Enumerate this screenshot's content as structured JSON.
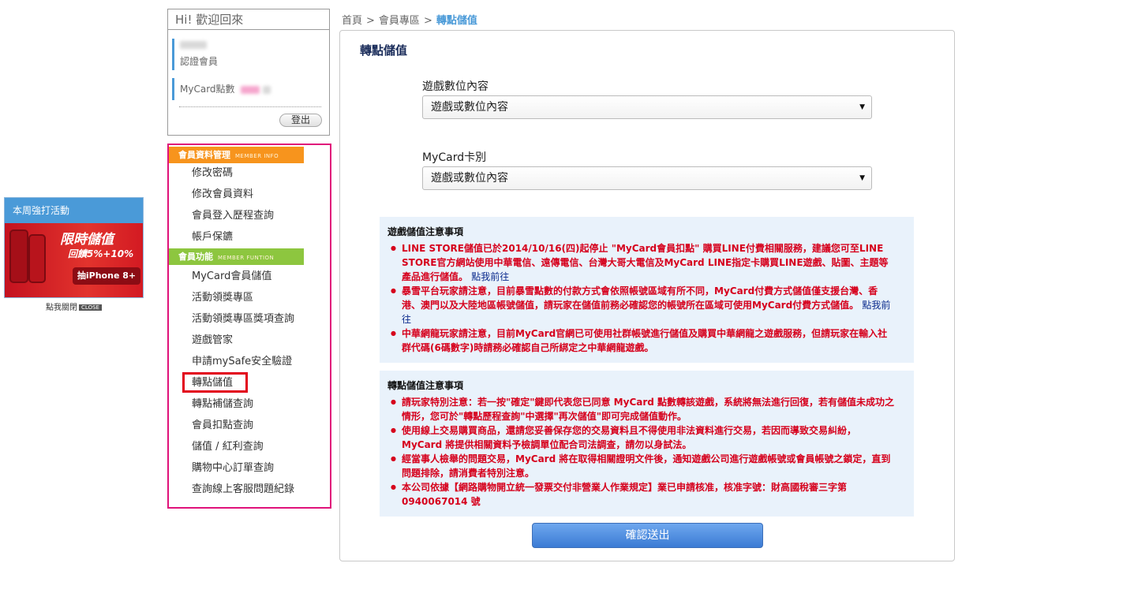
{
  "promo": {
    "header": "本周強打活動",
    "banner_title": "限時儲值",
    "banner_subtitle": "回饋5%+10%",
    "banner_button": "抽iPhone 8+",
    "close_text": "點我關閉",
    "close_tag": "CLOSE"
  },
  "welcome": {
    "title": "Hi! 歡迎回來",
    "member_type": "認證會員",
    "points_label": "MyCard點數",
    "logout": "登出"
  },
  "menu": {
    "section1": {
      "label": "會員資料管理",
      "en": "MEMBER INFO",
      "color": "#f7941d"
    },
    "section1_items": [
      "修改密碼",
      "修改會員資料",
      "會員登入歷程查詢",
      "帳戶保鑣"
    ],
    "section2": {
      "label": "會員功能",
      "en": "MEMBER FUNTION",
      "color": "#8dc63f"
    },
    "section2_items": [
      "MyCard會員儲值",
      "活動領獎專區",
      "活動領獎專區獎項查詢",
      "遊戲管家",
      "申請mySafe安全驗證",
      "轉點儲值",
      "轉點補儲查詢",
      "會員扣點查詢",
      "儲值 / 紅利查詢",
      "購物中心訂單查詢",
      "查詢線上客服問題紀錄"
    ]
  },
  "breadcrumb": {
    "home": "首頁",
    "sep": ">",
    "member": "會員專區",
    "current": "轉點儲值"
  },
  "main": {
    "title": "轉點儲值",
    "field1_label": "遊戲數位內容",
    "field1_value": "遊戲或數位內容",
    "field2_label": "MyCard卡別",
    "field2_value": "遊戲或數位內容",
    "notice1_title": "遊戲儲值注意事項",
    "notice1_items": [
      "LINE STORE儲值已於2014/10/16(四)起停止 \"MyCard會員扣點\" 購買LINE付費相關服務，建議您可至LINE STORE官方網站使用中華電信、遠傳電信、台灣大哥大電信及MyCard LINE指定卡購買LINE遊戲、貼圖、主題等產品進行儲值。",
      "暴雪平台玩家請注意，目前暴雪點數的付款方式會依照帳號區域有所不同，MyCard付費方式儲值僅支援台灣、香港、澳門以及大陸地區帳號儲值，請玩家在儲值前務必確認您的帳號所在區域可使用MyCard付費方式儲值。",
      "中華網龍玩家請注意，目前MyCard官網已可使用社群帳號進行儲值及購買中華網龍之遊戲服務，但請玩家在輸入社群代碼(6碼數字)時請務必確認自己所綁定之中華網龍遊戲。"
    ],
    "notice1_link": "點我前往",
    "notice2_title": "轉點儲值注意事項",
    "notice2_items": [
      "請玩家特別注意：若一按\"確定\"鍵即代表您已同意 MyCard 點數轉該遊戲，系統將無法進行回復，若有儲值未成功之情形，您可於\"轉點歷程查詢\"中選擇\"再次儲值\"即可完成儲值動作。",
      "使用線上交易購買商品，還請您妥善保存您的交易資料且不得使用非法資料進行交易，若因而導致交易糾紛，MyCard 將提供相關資料予檢調單位配合司法調查，請勿以身試法。",
      "經當事人檢舉的問題交易，MyCard 將在取得相關證明文件後，通知遊戲公司進行遊戲帳號或會員帳號之鎖定，直到問題排除，請消費者特別注意。",
      "本公司依據【網路購物開立統一發票交付非營業人作業規定】業已申請核准，核准字號：財高國稅審三字第 0940067014 號"
    ],
    "submit": "確認送出"
  }
}
